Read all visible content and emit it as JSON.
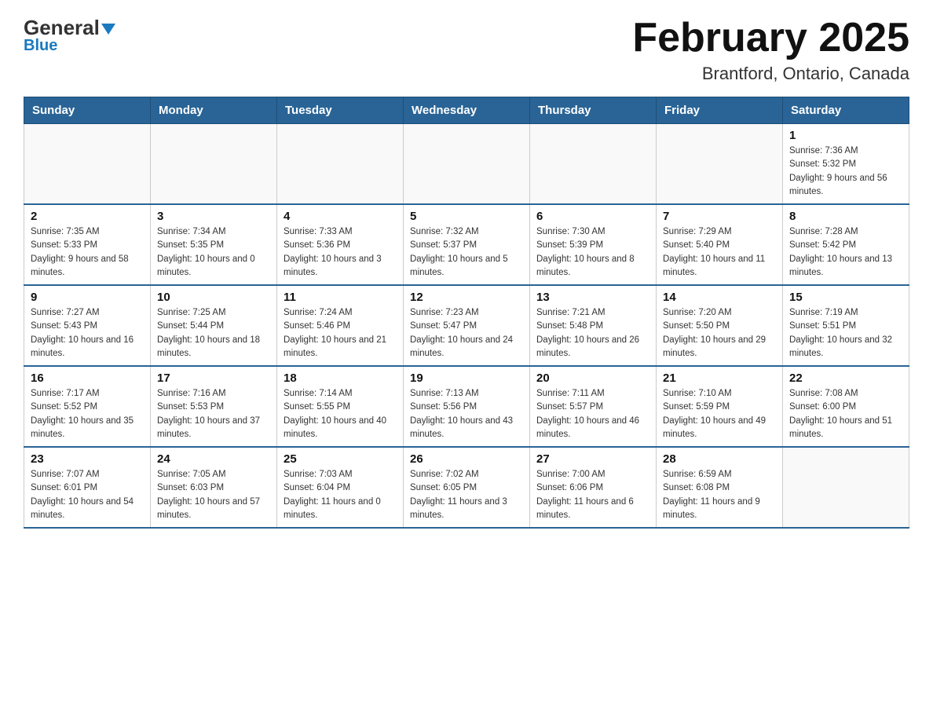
{
  "header": {
    "logo_general": "General",
    "logo_blue": "Blue",
    "title": "February 2025",
    "subtitle": "Brantford, Ontario, Canada"
  },
  "weekdays": [
    "Sunday",
    "Monday",
    "Tuesday",
    "Wednesday",
    "Thursday",
    "Friday",
    "Saturday"
  ],
  "weeks": [
    [
      {
        "day": "",
        "info": ""
      },
      {
        "day": "",
        "info": ""
      },
      {
        "day": "",
        "info": ""
      },
      {
        "day": "",
        "info": ""
      },
      {
        "day": "",
        "info": ""
      },
      {
        "day": "",
        "info": ""
      },
      {
        "day": "1",
        "info": "Sunrise: 7:36 AM\nSunset: 5:32 PM\nDaylight: 9 hours and 56 minutes."
      }
    ],
    [
      {
        "day": "2",
        "info": "Sunrise: 7:35 AM\nSunset: 5:33 PM\nDaylight: 9 hours and 58 minutes."
      },
      {
        "day": "3",
        "info": "Sunrise: 7:34 AM\nSunset: 5:35 PM\nDaylight: 10 hours and 0 minutes."
      },
      {
        "day": "4",
        "info": "Sunrise: 7:33 AM\nSunset: 5:36 PM\nDaylight: 10 hours and 3 minutes."
      },
      {
        "day": "5",
        "info": "Sunrise: 7:32 AM\nSunset: 5:37 PM\nDaylight: 10 hours and 5 minutes."
      },
      {
        "day": "6",
        "info": "Sunrise: 7:30 AM\nSunset: 5:39 PM\nDaylight: 10 hours and 8 minutes."
      },
      {
        "day": "7",
        "info": "Sunrise: 7:29 AM\nSunset: 5:40 PM\nDaylight: 10 hours and 11 minutes."
      },
      {
        "day": "8",
        "info": "Sunrise: 7:28 AM\nSunset: 5:42 PM\nDaylight: 10 hours and 13 minutes."
      }
    ],
    [
      {
        "day": "9",
        "info": "Sunrise: 7:27 AM\nSunset: 5:43 PM\nDaylight: 10 hours and 16 minutes."
      },
      {
        "day": "10",
        "info": "Sunrise: 7:25 AM\nSunset: 5:44 PM\nDaylight: 10 hours and 18 minutes."
      },
      {
        "day": "11",
        "info": "Sunrise: 7:24 AM\nSunset: 5:46 PM\nDaylight: 10 hours and 21 minutes."
      },
      {
        "day": "12",
        "info": "Sunrise: 7:23 AM\nSunset: 5:47 PM\nDaylight: 10 hours and 24 minutes."
      },
      {
        "day": "13",
        "info": "Sunrise: 7:21 AM\nSunset: 5:48 PM\nDaylight: 10 hours and 26 minutes."
      },
      {
        "day": "14",
        "info": "Sunrise: 7:20 AM\nSunset: 5:50 PM\nDaylight: 10 hours and 29 minutes."
      },
      {
        "day": "15",
        "info": "Sunrise: 7:19 AM\nSunset: 5:51 PM\nDaylight: 10 hours and 32 minutes."
      }
    ],
    [
      {
        "day": "16",
        "info": "Sunrise: 7:17 AM\nSunset: 5:52 PM\nDaylight: 10 hours and 35 minutes."
      },
      {
        "day": "17",
        "info": "Sunrise: 7:16 AM\nSunset: 5:53 PM\nDaylight: 10 hours and 37 minutes."
      },
      {
        "day": "18",
        "info": "Sunrise: 7:14 AM\nSunset: 5:55 PM\nDaylight: 10 hours and 40 minutes."
      },
      {
        "day": "19",
        "info": "Sunrise: 7:13 AM\nSunset: 5:56 PM\nDaylight: 10 hours and 43 minutes."
      },
      {
        "day": "20",
        "info": "Sunrise: 7:11 AM\nSunset: 5:57 PM\nDaylight: 10 hours and 46 minutes."
      },
      {
        "day": "21",
        "info": "Sunrise: 7:10 AM\nSunset: 5:59 PM\nDaylight: 10 hours and 49 minutes."
      },
      {
        "day": "22",
        "info": "Sunrise: 7:08 AM\nSunset: 6:00 PM\nDaylight: 10 hours and 51 minutes."
      }
    ],
    [
      {
        "day": "23",
        "info": "Sunrise: 7:07 AM\nSunset: 6:01 PM\nDaylight: 10 hours and 54 minutes."
      },
      {
        "day": "24",
        "info": "Sunrise: 7:05 AM\nSunset: 6:03 PM\nDaylight: 10 hours and 57 minutes."
      },
      {
        "day": "25",
        "info": "Sunrise: 7:03 AM\nSunset: 6:04 PM\nDaylight: 11 hours and 0 minutes."
      },
      {
        "day": "26",
        "info": "Sunrise: 7:02 AM\nSunset: 6:05 PM\nDaylight: 11 hours and 3 minutes."
      },
      {
        "day": "27",
        "info": "Sunrise: 7:00 AM\nSunset: 6:06 PM\nDaylight: 11 hours and 6 minutes."
      },
      {
        "day": "28",
        "info": "Sunrise: 6:59 AM\nSunset: 6:08 PM\nDaylight: 11 hours and 9 minutes."
      },
      {
        "day": "",
        "info": ""
      }
    ]
  ]
}
